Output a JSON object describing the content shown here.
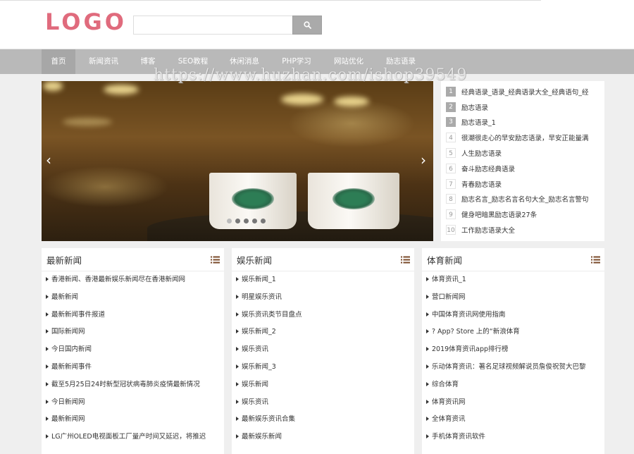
{
  "logo": "LOGO",
  "search": {
    "placeholder": ""
  },
  "nav": [
    "首页",
    "新闻资讯",
    "博客",
    "SEO教程",
    "休闲消息",
    "PHP学习",
    "网站优化",
    "励志语录"
  ],
  "watermark": "https://www.huzhan.com/ishop39549",
  "slider": {
    "prev": "‹",
    "next": "›",
    "slide_count": 5,
    "active_slide": 1
  },
  "top_list": [
    {
      "num": "1",
      "title": "经典语录_语录_经典语录大全_经典语句_经"
    },
    {
      "num": "2",
      "title": "励志语录"
    },
    {
      "num": "3",
      "title": "励志语录_1"
    },
    {
      "num": "4",
      "title": "很潮很走心的早安励志语录，早安正能量满"
    },
    {
      "num": "5",
      "title": "人生励志语录"
    },
    {
      "num": "6",
      "title": "奋斗励志经典语录"
    },
    {
      "num": "7",
      "title": "青春励志语录"
    },
    {
      "num": "8",
      "title": "励志名言_励志名言名句大全_励志名言警句"
    },
    {
      "num": "9",
      "title": "健身吧暗黑励志语录27条"
    },
    {
      "num": "10",
      "title": "工作励志语录大全"
    }
  ],
  "panels": [
    {
      "title": "最新新闻",
      "items": [
        "香港新闻、香港最新娱乐新闻尽在香港新闻网",
        "最新新闻",
        "最新新闻事件报道",
        "国际新闻网",
        "今日国内新闻",
        "最新新闻事件",
        "截至5月25日24时新型冠状病毒肺炎疫情最新情况",
        "今日新闻网",
        "最新新闻网",
        "LG广州OLED电视面板工厂量产时间又延迟，将推迟"
      ]
    },
    {
      "title": "娱乐新闻",
      "items": [
        "娱乐新闻_1",
        "明星娱乐资讯",
        "娱乐资讯类节目盘点",
        "娱乐新闻_2",
        "娱乐资讯",
        "娱乐新闻_3",
        "娱乐新闻",
        "娱乐资讯",
        "最新娱乐资讯合集",
        "最新娱乐新闻"
      ]
    },
    {
      "title": "体育新闻",
      "items": [
        "体育资讯_1",
        "营口新闻网",
        "中国体育资讯网使用指南",
        "? App? Store 上的“新浪体育",
        "2019体育资讯app排行榜",
        "乐动体育资讯：著名足球视频解说员詹俊祝贺大巴黎",
        "综合体育",
        "体育资讯网",
        "全体育资讯",
        "手机体育资讯软件"
      ]
    }
  ],
  "colors": {
    "logo": "#e06b7d",
    "nav_bg": "#b9b9b9",
    "nav_active": "#a7a7a7",
    "page_bg": "#efefef"
  }
}
